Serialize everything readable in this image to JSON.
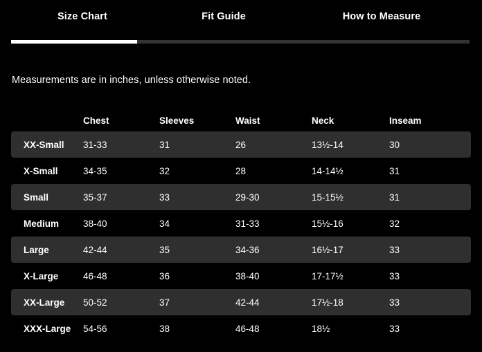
{
  "tabs": [
    {
      "label": "Size Chart",
      "active": true
    },
    {
      "label": "Fit Guide",
      "active": false
    },
    {
      "label": "How to Measure",
      "active": false
    }
  ],
  "indicator": {
    "track_color": "#333333",
    "thumb_color": "#ffffff"
  },
  "subtitle": "Measurements are in inches, unless otherwise noted.",
  "theme": {
    "background": "#000000",
    "stripe": "#2f2f2f",
    "text": "#ffffff"
  },
  "table": {
    "columns": [
      "",
      "Chest",
      "Sleeves",
      "Waist",
      "Neck",
      "Inseam"
    ],
    "rows": [
      {
        "size": "XX-Small",
        "chest": "31-33",
        "sleeves": "31",
        "waist": "26",
        "neck": "13½-14",
        "inseam": "30"
      },
      {
        "size": "X-Small",
        "chest": "34-35",
        "sleeves": "32",
        "waist": "28",
        "neck": "14-14½",
        "inseam": "31"
      },
      {
        "size": "Small",
        "chest": "35-37",
        "sleeves": "33",
        "waist": "29-30",
        "neck": "15-15½",
        "inseam": "31"
      },
      {
        "size": "Medium",
        "chest": "38-40",
        "sleeves": "34",
        "waist": "31-33",
        "neck": "15½-16",
        "inseam": "32"
      },
      {
        "size": "Large",
        "chest": "42-44",
        "sleeves": "35",
        "waist": "34-36",
        "neck": "16½-17",
        "inseam": "33"
      },
      {
        "size": "X-Large",
        "chest": "46-48",
        "sleeves": "36",
        "waist": "38-40",
        "neck": "17-17½",
        "inseam": "33"
      },
      {
        "size": "XX-Large",
        "chest": "50-52",
        "sleeves": "37",
        "waist": "42-44",
        "neck": "17½-18",
        "inseam": "33"
      },
      {
        "size": "XXX-Large",
        "chest": "54-56",
        "sleeves": "38",
        "waist": "46-48",
        "neck": "18½",
        "inseam": "33"
      }
    ]
  }
}
